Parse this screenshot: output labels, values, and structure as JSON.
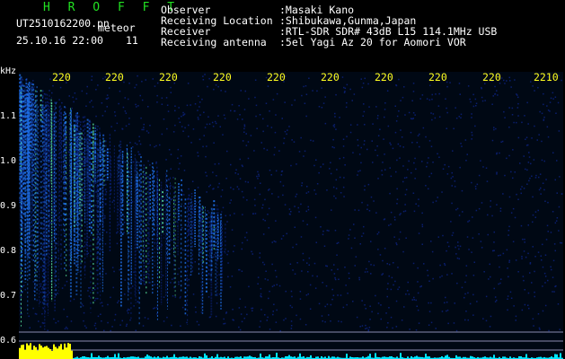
{
  "header": {
    "title": "H R O F F T",
    "filename": "UT2510162200.pn",
    "meteor_label": "meteor",
    "datetime": "25.10.16 22:00",
    "count": "11"
  },
  "info": [
    {
      "label": "Observer",
      "value": ":Masaki Kano"
    },
    {
      "label": "Receiving Location",
      "value": ":Shibukawa,Gunma,Japan"
    },
    {
      "label": "Receiver",
      "value": ":RTL-SDR SDR# 43dB L15 114.1MHz USB"
    },
    {
      "label": "Receiving antenna",
      "value": ":5el Yagi Az 20 for Aomori VOR"
    }
  ],
  "axis": {
    "unit": "kHz",
    "y_ticks": [
      "1.1",
      "1.0",
      "0.9",
      "0.8",
      "0.7",
      "0.6"
    ],
    "x_ticks": [
      "220",
      "220",
      "220",
      "220",
      "220",
      "220",
      "220",
      "220",
      "220",
      "2210"
    ]
  },
  "colors": {
    "background": "#000000",
    "text": "#ffffff",
    "title": "#22e222",
    "x_tick": "#ffff20",
    "signal_low": "#0a1e6e",
    "signal_mid": "#1e6ee6",
    "signal_high": "#5ae6a0",
    "meter_yellow": "#ffff00",
    "meter_cyan": "#00e6ff"
  }
}
